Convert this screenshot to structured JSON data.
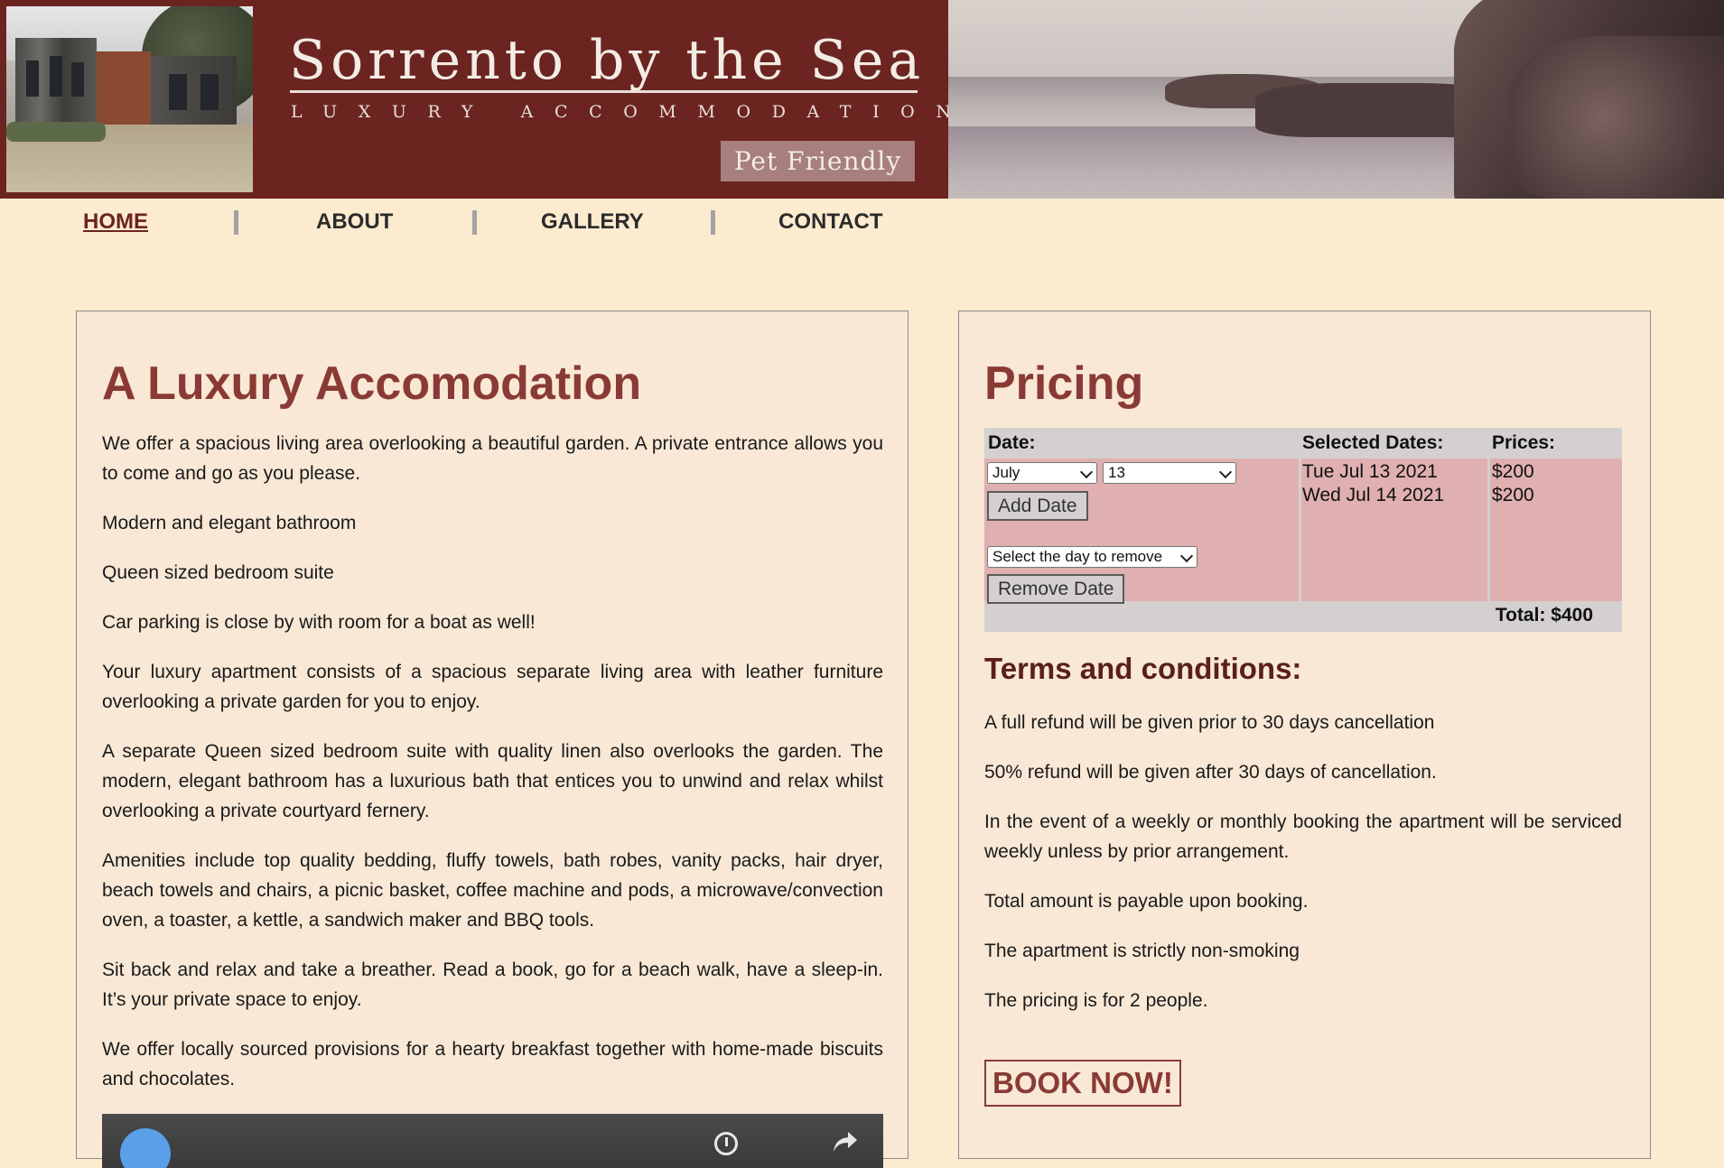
{
  "header": {
    "title": "Sorrento by the Sea",
    "tagline": "LUXURY ACCOMMODATION",
    "badge": "Pet Friendly",
    "brand_color": "#6c2421"
  },
  "nav": {
    "items": [
      {
        "label": "HOME",
        "active": true
      },
      {
        "label": "ABOUT",
        "active": false
      },
      {
        "label": "GALLERY",
        "active": false
      },
      {
        "label": "CONTACT",
        "active": false
      }
    ]
  },
  "about": {
    "heading": "A Luxury Accomodation",
    "paragraphs": [
      "We offer a spacious living area overlooking a beautiful garden. A private entrance allows you to come and go as you please.",
      "Modern and elegant bathroom",
      "Queen sized bedroom suite",
      "Car parking is close by with room for a boat as well!",
      "Your luxury apartment consists of a spacious separate living area with leather furniture overlooking a private garden for you to enjoy.",
      "A separate Queen sized bedroom suite with quality linen also overlooks the garden. The modern, elegant bathroom has a luxurious bath that entices you to unwind and relax whilst overlooking a private courtyard fernery.",
      "Amenities include top quality bedding, fluffy towels, bath robes, vanity packs, hair dryer, beach towels and chairs, a picnic basket, coffee machine and pods, a microwave/convection oven, a toaster, a kettle, a sandwich maker and BBQ tools.",
      "Sit back and relax and take a breather. Read a book, go for a beach walk, have a sleep-in. It’s your private space to enjoy.",
      "We offer locally sourced provisions for a hearty breakfast together with home-made biscuits and chocolates."
    ]
  },
  "pricing": {
    "heading": "Pricing",
    "col_date": "Date:",
    "col_selected": "Selected Dates:",
    "col_prices": "Prices:",
    "month_select": "July",
    "day_select": "13",
    "add_button": "Add Date",
    "remove_select": "Select the day to remove",
    "remove_button": "Remove Date",
    "selected_dates": [
      "Tue Jul 13 2021",
      "Wed Jul 14 2021"
    ],
    "prices": [
      "$200",
      "$200"
    ],
    "total": "Total: $400"
  },
  "terms": {
    "heading": "Terms and conditions:",
    "items": [
      "A full refund will be given prior to 30 days cancellation",
      "50% refund will be given after 30 days of cancellation.",
      "In the event of a weekly or monthly booking the apartment will be serviced weekly unless by prior arrangement.",
      "Total amount is payable upon booking.",
      "The apartment is strictly non-smoking",
      "The pricing is for 2 people."
    ],
    "book_button": "BOOK NOW!"
  }
}
